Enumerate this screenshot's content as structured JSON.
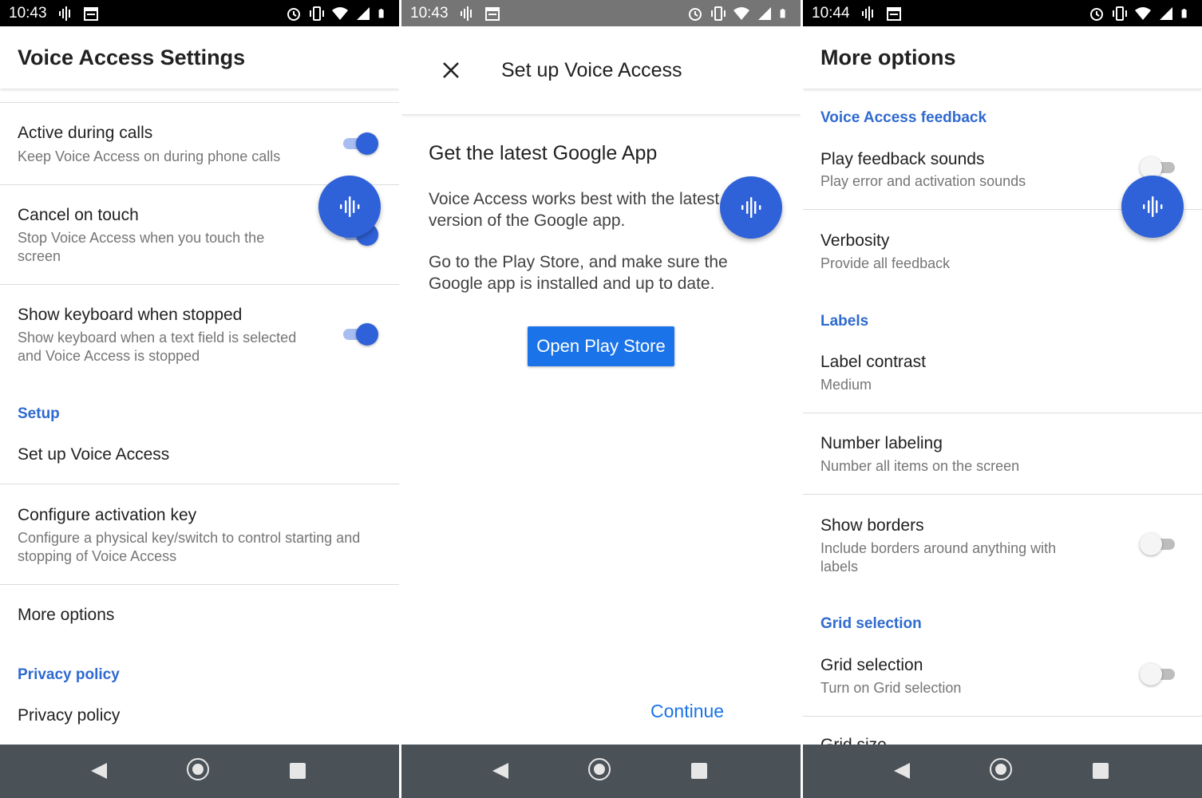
{
  "screens": [
    {
      "status_time": "10:43",
      "title": "Voice Access Settings",
      "items": [
        {
          "title": "Active during calls",
          "subtitle": "Keep Voice Access on during phone calls"
        },
        {
          "title": "Cancel on touch",
          "subtitle": "Stop Voice Access when you touch the screen"
        },
        {
          "title": "Show keyboard when stopped",
          "subtitle": "Show keyboard when a text field is selected and Voice Access is stopped"
        },
        {
          "title": "Set up Voice Access"
        },
        {
          "title": "Configure activation key",
          "subtitle": "Configure a physical key/switch to control starting and stopping of Voice Access"
        },
        {
          "title": "More options"
        },
        {
          "title": "Privacy policy"
        }
      ],
      "sections": [
        "Setup",
        "Privacy policy"
      ]
    },
    {
      "status_time": "10:43",
      "title": "Set up Voice Access",
      "heading": "Get the latest Google App",
      "body1": "Voice Access works best with the latest version of the Google app.",
      "body2": "Go to the Play Store, and make sure the Google app is installed and up to date.",
      "primary_button": "Open Play Store",
      "continue_button": "Continue"
    },
    {
      "status_time": "10:44",
      "title": "More options",
      "sections": [
        "Voice Access feedback",
        "Labels",
        "Grid selection"
      ],
      "items": [
        {
          "title": "Play feedback sounds",
          "subtitle": "Play error and activation sounds"
        },
        {
          "title": "Verbosity",
          "subtitle": "Provide all feedback"
        },
        {
          "title": "Label contrast",
          "subtitle": "Medium"
        },
        {
          "title": "Number labeling",
          "subtitle": "Number all items on the screen"
        },
        {
          "title": "Show borders",
          "subtitle": "Include borders around anything with labels"
        },
        {
          "title": "Grid selection",
          "subtitle": "Turn on Grid selection"
        },
        {
          "title": "Grid size"
        }
      ]
    }
  ],
  "colors": {
    "accent": "#2f62d8",
    "link": "#2f6ad0",
    "button": "#1a73e8",
    "navbar": "#4a5258"
  }
}
